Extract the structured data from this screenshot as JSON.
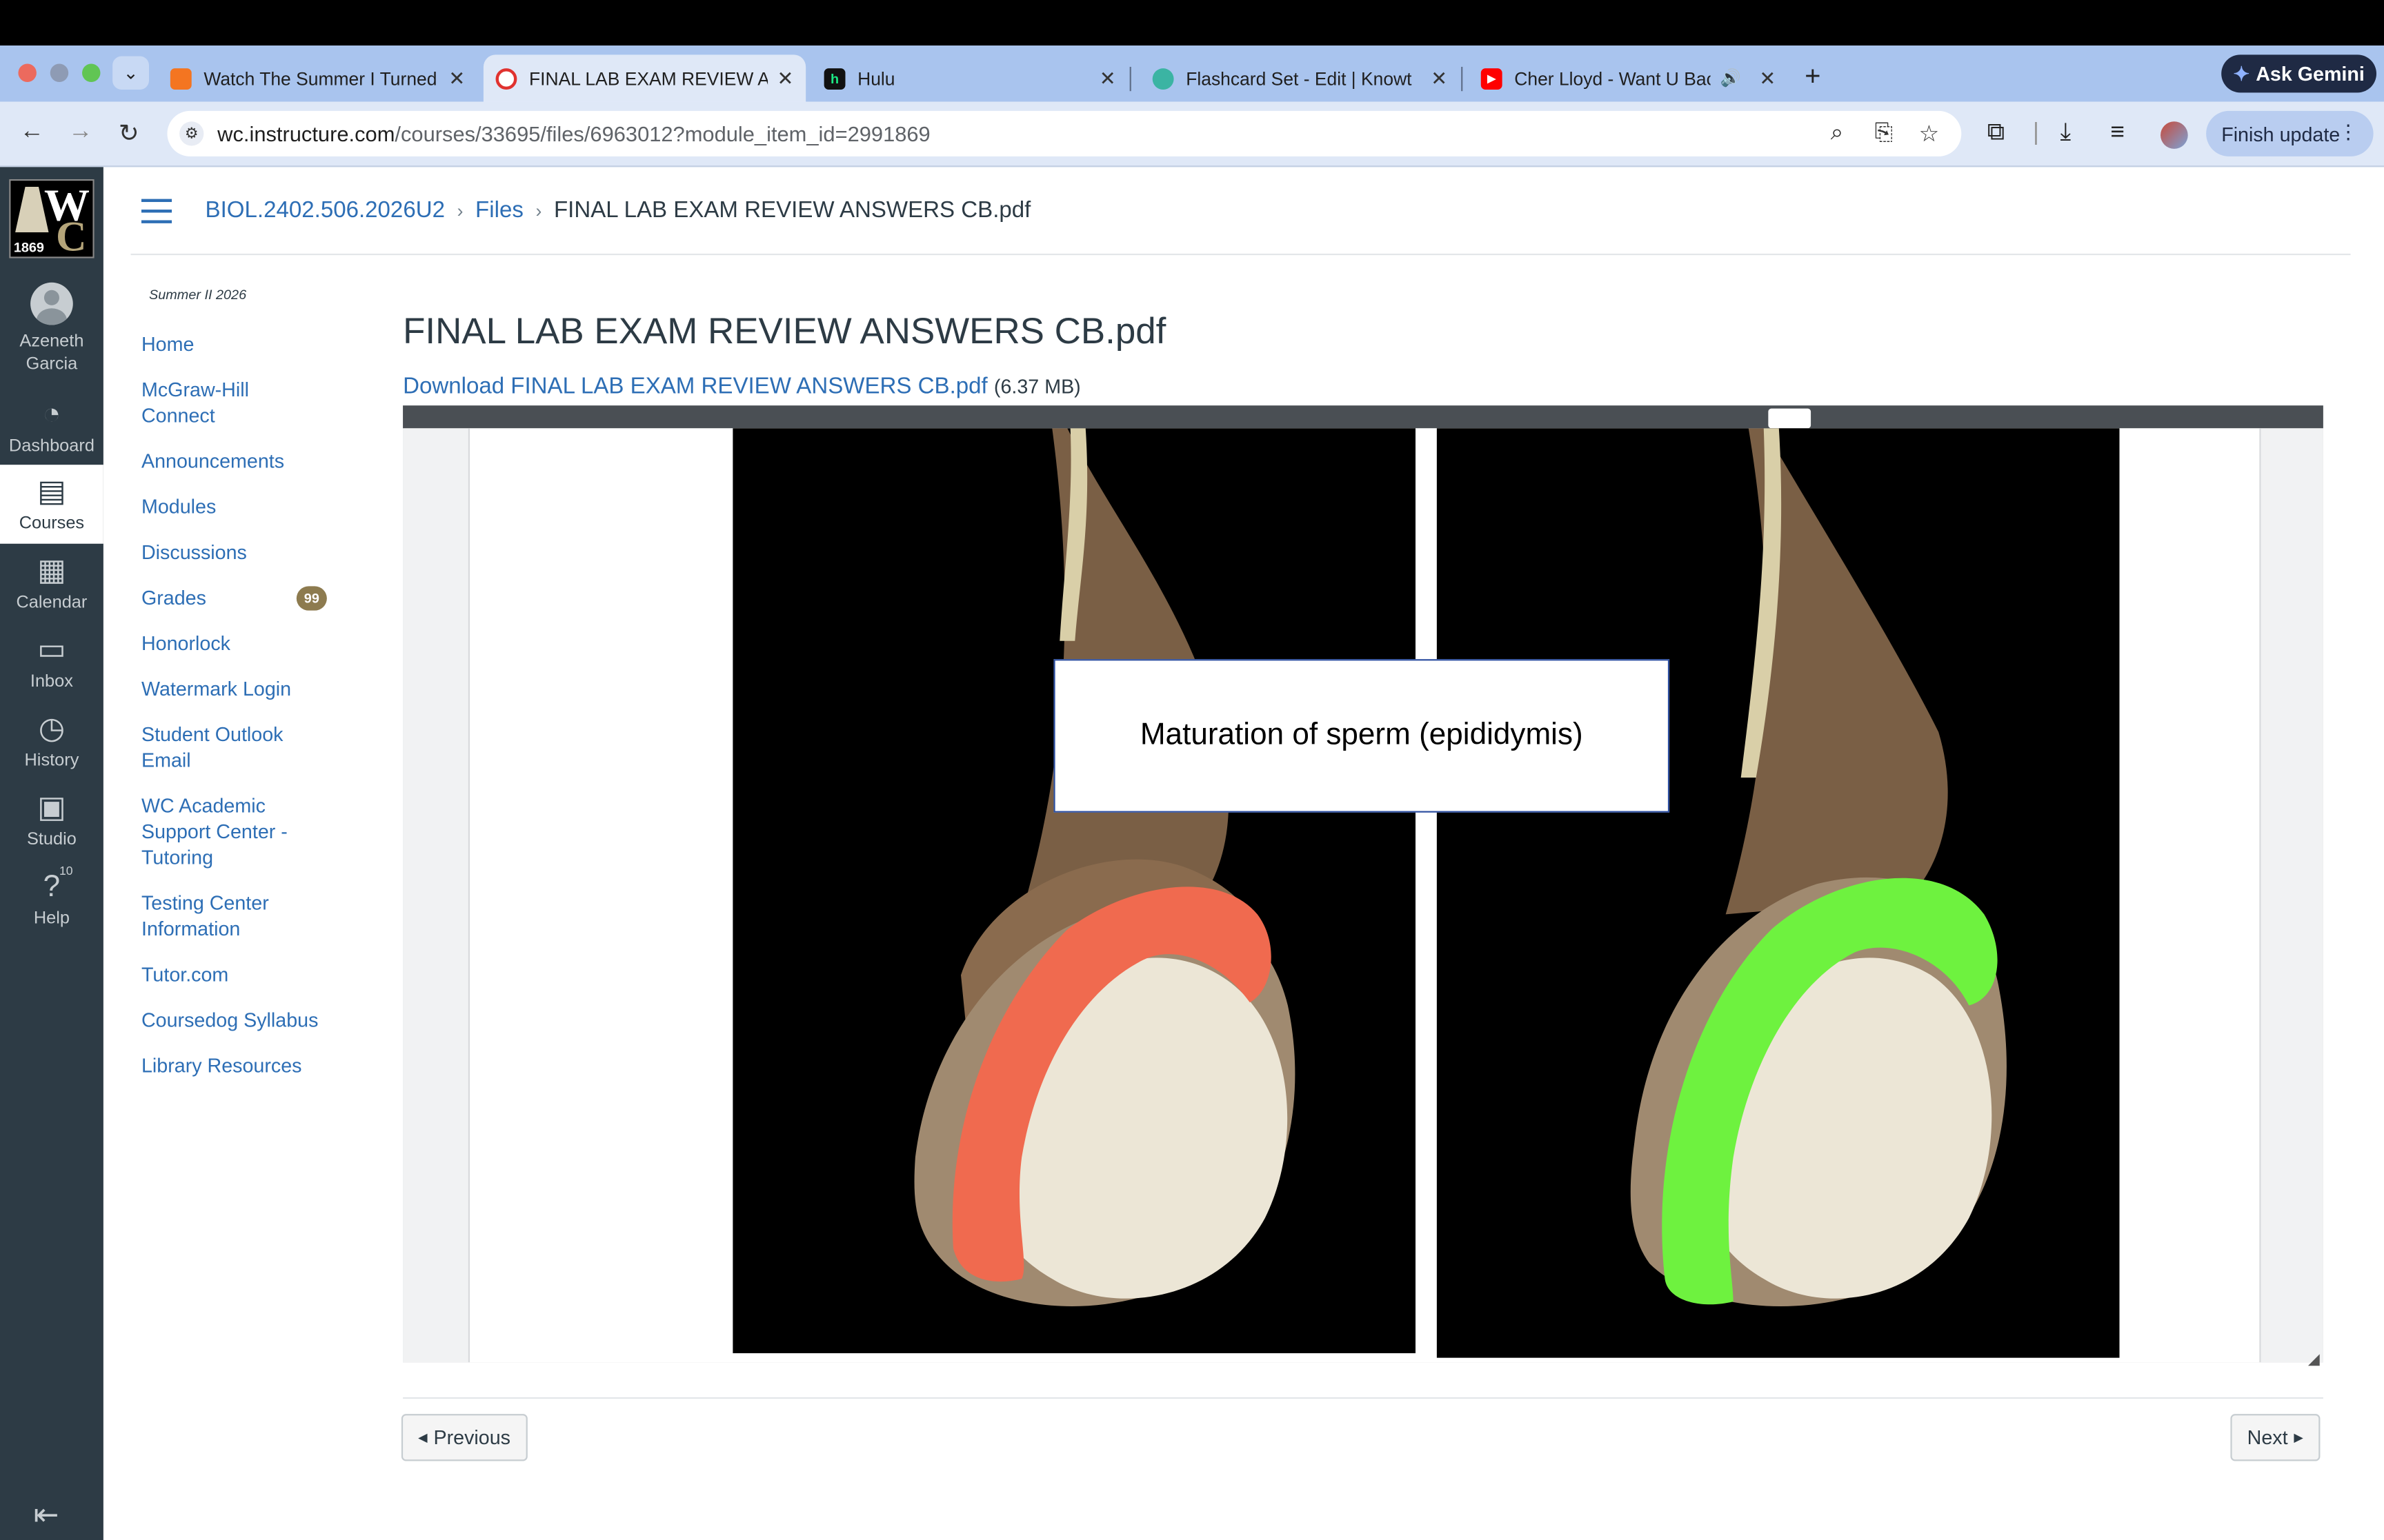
{
  "browser": {
    "tabs": [
      {
        "title": "Watch The Summer I Turned P",
        "icon_color": "#f47521",
        "icon_glyph": "",
        "active": false
      },
      {
        "title": "FINAL LAB EXAM REVIEW AN",
        "icon_color": "#e0322f",
        "icon_glyph": "",
        "active": true
      },
      {
        "title": "Hulu",
        "icon_color": "#111111",
        "icon_glyph": "h",
        "active": false
      },
      {
        "title": "Flashcard Set - Edit | Knowt",
        "icon_color": "#3bb4a3",
        "icon_glyph": "",
        "active": false
      },
      {
        "title": "Cher Lloyd - Want U Back",
        "icon_color": "#ff0000",
        "icon_glyph": "▶",
        "active": false
      }
    ],
    "ask_gemini": "Ask Gemini",
    "url_host": "wc.instructure.com",
    "url_path": "/courses/33695/files/6963012?module_item_id=2991869",
    "finish_update": "Finish update"
  },
  "global_nav": {
    "logo_year": "1869",
    "user_name": "Azeneth Garcia",
    "items": [
      {
        "label": "Dashboard",
        "icon": "dashboard-icon"
      },
      {
        "label": "Courses",
        "icon": "courses-icon"
      },
      {
        "label": "Calendar",
        "icon": "calendar-icon"
      },
      {
        "label": "Inbox",
        "icon": "inbox-icon"
      },
      {
        "label": "History",
        "icon": "history-icon"
      },
      {
        "label": "Studio",
        "icon": "studio-icon"
      },
      {
        "label": "Help",
        "icon": "help-icon",
        "badge": "10"
      }
    ]
  },
  "breadcrumb": {
    "course": "BIOL.2402.506.2026U2",
    "section": "Files",
    "file": "FINAL LAB EXAM REVIEW ANSWERS CB.pdf"
  },
  "course_nav": {
    "term": "Summer II 2026",
    "items": [
      {
        "label": "Home"
      },
      {
        "label": "McGraw-Hill Connect"
      },
      {
        "label": "Announcements"
      },
      {
        "label": "Modules"
      },
      {
        "label": "Discussions"
      },
      {
        "label": "Grades",
        "badge": "99"
      },
      {
        "label": "Honorlock"
      },
      {
        "label": "Watermark Login"
      },
      {
        "label": "Student Outlook Email"
      },
      {
        "label": "WC Academic Support Center - Tutoring"
      },
      {
        "label": "Testing Center Information"
      },
      {
        "label": "Tutor.com"
      },
      {
        "label": "Coursedog Syllabus"
      },
      {
        "label": "Library Resources"
      }
    ]
  },
  "content": {
    "title": "FINAL LAB EXAM REVIEW ANSWERS CB.pdf",
    "download_label": "Download FINAL LAB EXAM REVIEW ANSWERS CB.pdf",
    "file_size": "(6.37 MB)",
    "slide_caption": "Maturation of sperm (epididymis)",
    "highlight_left_color": "#f06a4f",
    "highlight_right_color": "#6ef23f",
    "previous_label": "Previous",
    "next_label": "Next"
  }
}
